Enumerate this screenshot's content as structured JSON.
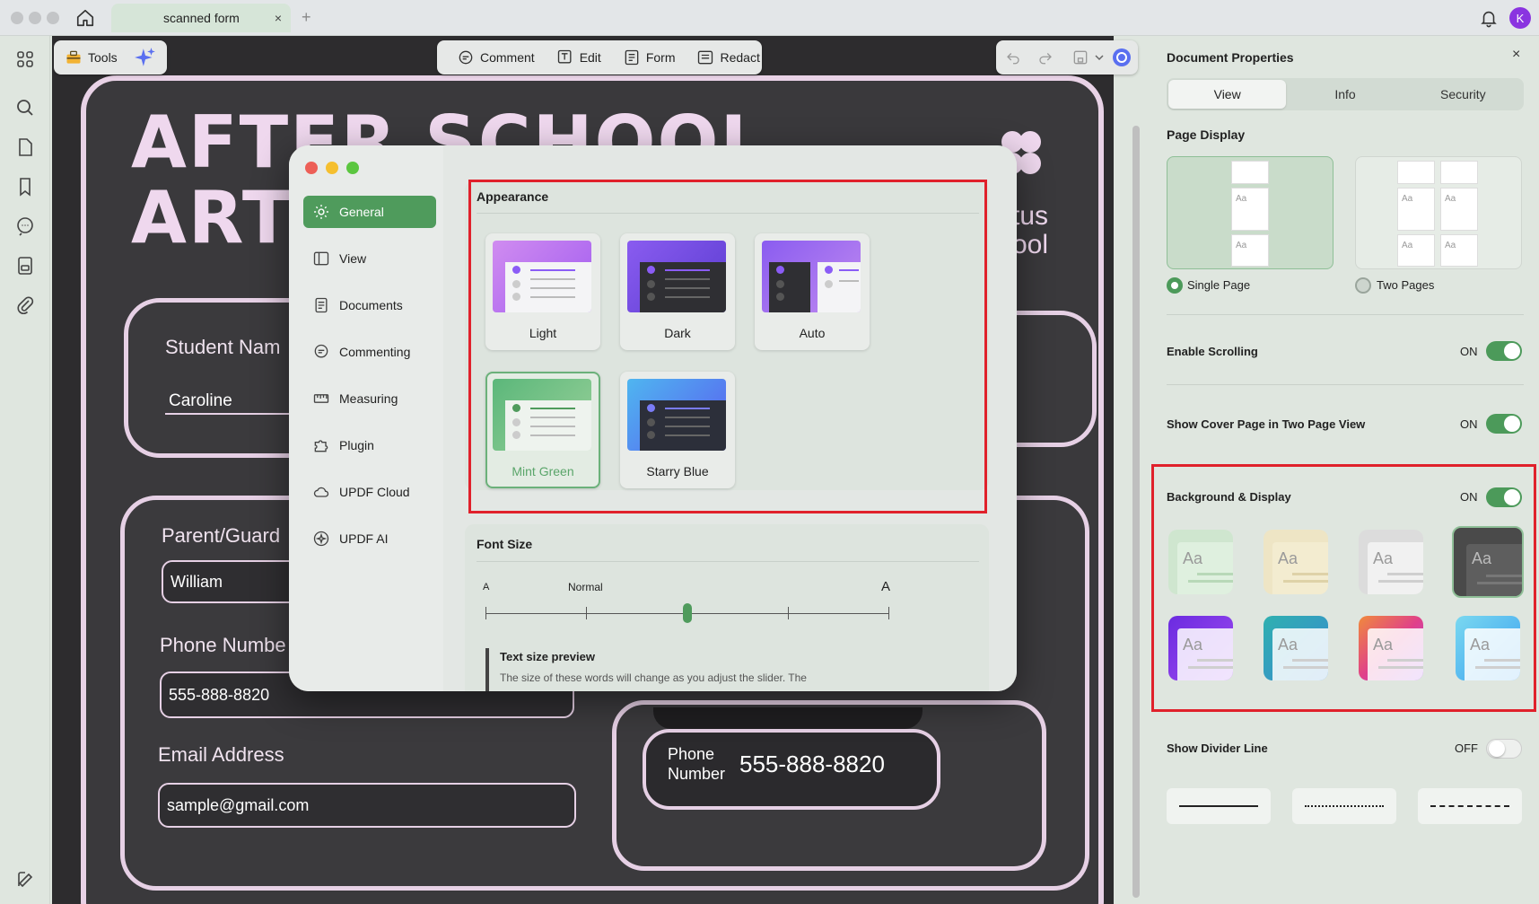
{
  "window": {
    "tab_title": "scanned form",
    "tab_close": "×",
    "tab_add": "+",
    "avatar_initial": "K"
  },
  "toolbar": {
    "tools_label": "Tools",
    "comment_label": "Comment",
    "edit_label": "Edit",
    "form_label": "Form",
    "redact_label": "Redact"
  },
  "document": {
    "title_line1": "AFTER SCHOOL",
    "title_line2": "ART",
    "side_text1": "tus",
    "side_text2": "ool",
    "student_label": "Student Nam",
    "student_value": "Caroline",
    "parent_label": "Parent/Guard",
    "parent_value": "William",
    "phone_label": "Phone Numbe",
    "phone_value": "555-888-8820",
    "email_label": "Email Address",
    "email_value": "sample@gmail.com",
    "phone_box_label1": "Phone",
    "phone_box_label2": "Number",
    "phone_box_value": "555-888-8820"
  },
  "preferences": {
    "nav": [
      {
        "label": "General",
        "icon": "gear-icon"
      },
      {
        "label": "View",
        "icon": "view-icon"
      },
      {
        "label": "Documents",
        "icon": "document-icon"
      },
      {
        "label": "Commenting",
        "icon": "comment-icon"
      },
      {
        "label": "Measuring",
        "icon": "ruler-icon"
      },
      {
        "label": "Plugin",
        "icon": "plugin-icon"
      },
      {
        "label": "UPDF Cloud",
        "icon": "cloud-icon"
      },
      {
        "label": "UPDF AI",
        "icon": "ai-icon"
      }
    ],
    "appearance_title": "Appearance",
    "themes": [
      {
        "label": "Light"
      },
      {
        "label": "Dark"
      },
      {
        "label": "Auto"
      },
      {
        "label": "Mint Green"
      },
      {
        "label": "Starry Blue"
      }
    ],
    "font_size_title": "Font Size",
    "font_small": "A",
    "font_normal": "Normal",
    "font_large": "A",
    "preview_title": "Text size preview",
    "preview_text": "The size of these words will change as you adjust the slider. The",
    "font_level": 0.5
  },
  "panel": {
    "title": "Document Properties",
    "close": "×",
    "tabs": [
      "View",
      "Info",
      "Security"
    ],
    "page_display_title": "Page Display",
    "single_page": "Single Page",
    "two_pages": "Two Pages",
    "enable_scrolling": "Enable Scrolling",
    "enable_scrolling_state": "ON",
    "cover_page": "Show Cover Page in Two Page View",
    "cover_page_state": "ON",
    "background_display": "Background & Display",
    "background_display_state": "ON",
    "swatch_text": "Aa",
    "divider_line": "Show Divider Line",
    "divider_line_state": "OFF"
  },
  "colors": {
    "accent": "#4f9b5c",
    "highlight": "#e0212b"
  }
}
